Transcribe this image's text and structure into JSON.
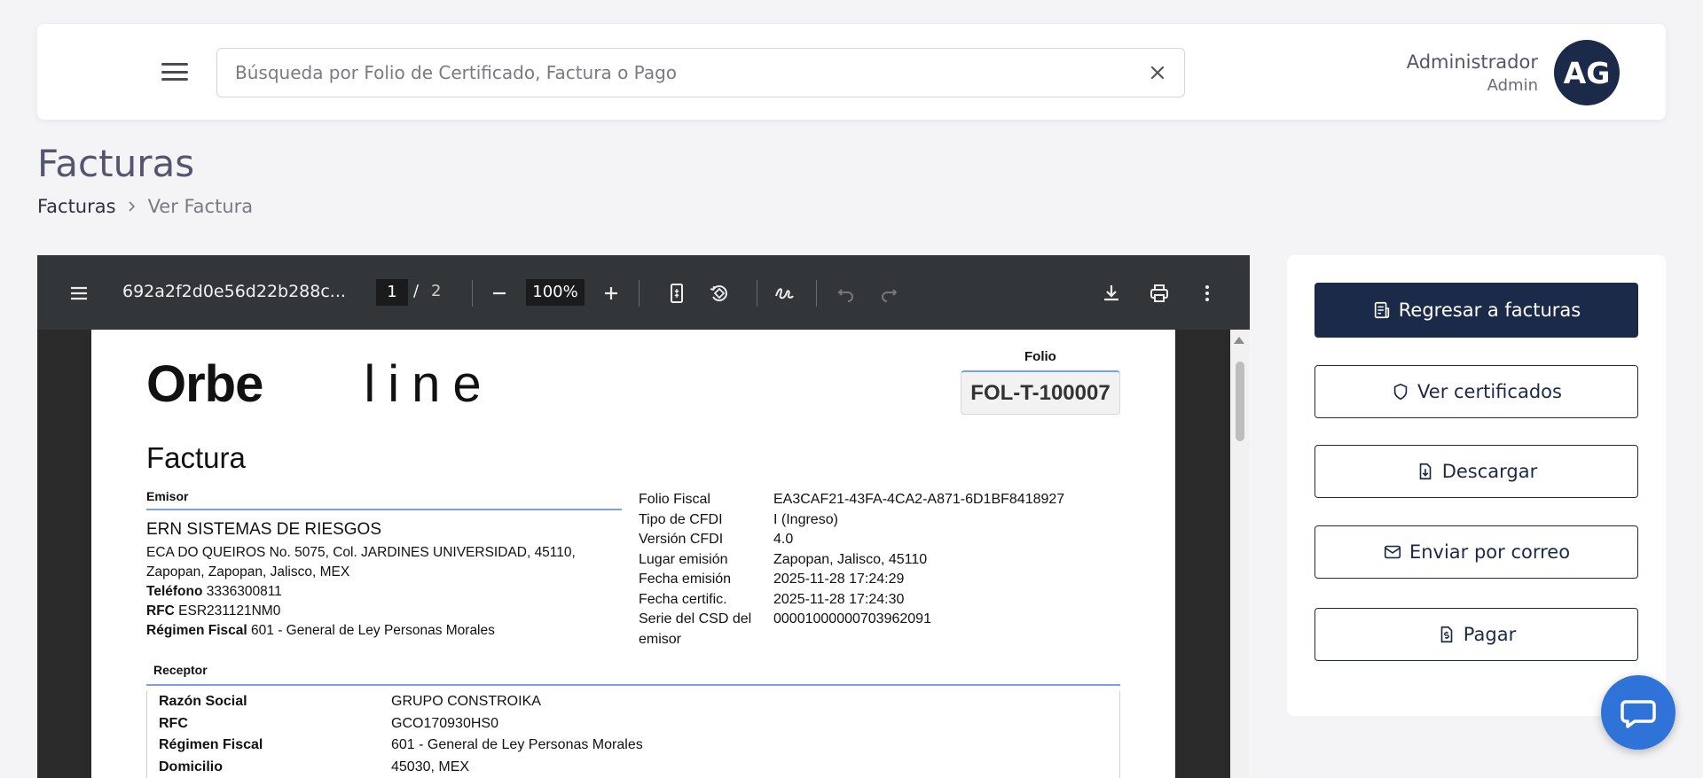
{
  "header": {
    "search_placeholder": "Búsqueda por Folio de Certificado, Factura o Pago",
    "user_role": "Administrador",
    "user_sub": "Admin",
    "avatar_initials": "AG"
  },
  "page": {
    "title": "Facturas",
    "breadcrumb": [
      "Facturas",
      "Ver Factura"
    ]
  },
  "viewer": {
    "file_name": "692a2f2d0e56d22b288c...",
    "current_page": "1",
    "page_separator": "/",
    "total_pages": "2",
    "zoom": "100%"
  },
  "document": {
    "logo_part1": "Orbe",
    "logo_part2": "line",
    "folio_label": "Folio",
    "folio_value": "FOL-T-100007",
    "title": "Factura",
    "emisor_label": "Emisor",
    "emisor": {
      "name": "ERN SISTEMAS DE RIESGOS",
      "address": "ECA DO QUEIROS No. 5075, Col. JARDINES UNIVERSIDAD, 45110, Zapopan, Zapopan, Jalisco, MEX",
      "telefono_label": "Teléfono",
      "telefono": "3336300811",
      "rfc_label": "RFC",
      "rfc": "ESR231121NM0",
      "regimen_label": "Régimen Fiscal",
      "regimen": "601 - General de Ley Personas Morales"
    },
    "fiscal": [
      {
        "k": "Folio Fiscal",
        "v": "EA3CAF21-43FA-4CA2-A871-6D1BF8418927"
      },
      {
        "k": "Tipo de CFDI",
        "v": "I (Ingreso)"
      },
      {
        "k": "Versión CFDI",
        "v": "4.0"
      },
      {
        "k": "Lugar emisión",
        "v": "Zapopan, Jalisco, 45110"
      },
      {
        "k": "Fecha emisión",
        "v": "2025-11-28 17:24:29"
      },
      {
        "k": "Fecha certific.",
        "v": "2025-11-28 17:24:30"
      },
      {
        "k": "Serie del CSD del emisor",
        "v": "00001000000703962091"
      }
    ],
    "receptor_label": "Receptor",
    "receptor": [
      {
        "k": "Razón Social",
        "v": "GRUPO CONSTROIKA"
      },
      {
        "k": "RFC",
        "v": "GCO170930HS0"
      },
      {
        "k": "Régimen Fiscal",
        "v": "601 - General de Ley Personas Morales"
      },
      {
        "k": "Domicilio",
        "v": "45030, MEX"
      }
    ]
  },
  "actions": {
    "back": "Regresar a facturas",
    "certificates": "Ver certificados",
    "download": "Descargar",
    "email": "Enviar por correo",
    "pay": "Pagar"
  },
  "colors": {
    "primary": "#1b2a48",
    "accent_line": "#7a9ee8",
    "chat": "#2f73d9"
  }
}
